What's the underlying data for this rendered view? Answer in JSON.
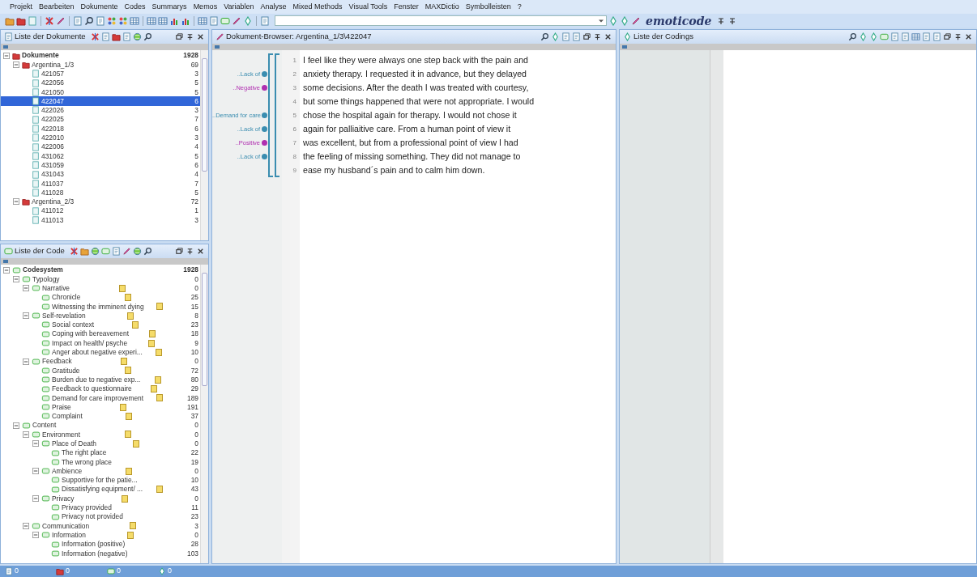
{
  "menu": [
    "Projekt",
    "Bearbeiten",
    "Dokumente",
    "Codes",
    "Summarys",
    "Memos",
    "Variablen",
    "Analyse",
    "Mixed Methods",
    "Visual Tools",
    "Fenster",
    "MAXDictio",
    "Symbolleisten",
    "?"
  ],
  "toolbar": {
    "logo": "emoticode"
  },
  "documents_panel": {
    "title": "Liste der Dokumente",
    "tree": [
      {
        "label": "Dokumente",
        "count": "1928",
        "kind": "root",
        "selected": false,
        "expanded": true,
        "children": [
          {
            "label": "Argentina_1/3",
            "count": "69",
            "kind": "set",
            "selected": false,
            "expanded": true,
            "children": [
              {
                "label": "421057",
                "count": "3",
                "kind": "doc",
                "selected": false
              },
              {
                "label": "422056",
                "count": "5",
                "kind": "doc",
                "selected": false
              },
              {
                "label": "421050",
                "count": "5",
                "kind": "doc",
                "selected": false
              },
              {
                "label": "422047",
                "count": "6",
                "kind": "doc",
                "selected": true
              },
              {
                "label": "422026",
                "count": "3",
                "kind": "doc",
                "selected": false
              },
              {
                "label": "422025",
                "count": "7",
                "kind": "doc",
                "selected": false
              },
              {
                "label": "422018",
                "count": "6",
                "kind": "doc",
                "selected": false
              },
              {
                "label": "422010",
                "count": "3",
                "kind": "doc",
                "selected": false
              },
              {
                "label": "422006",
                "count": "4",
                "kind": "doc",
                "selected": false
              },
              {
                "label": "431062",
                "count": "5",
                "kind": "doc",
                "selected": false
              },
              {
                "label": "431059",
                "count": "6",
                "kind": "doc",
                "selected": false
              },
              {
                "label": "431043",
                "count": "4",
                "kind": "doc",
                "selected": false
              },
              {
                "label": "411037",
                "count": "7",
                "kind": "doc",
                "selected": false
              },
              {
                "label": "411028",
                "count": "5",
                "kind": "doc",
                "selected": false
              }
            ]
          },
          {
            "label": "Argentina_2/3",
            "count": "72",
            "kind": "set",
            "selected": false,
            "expanded": true,
            "children": [
              {
                "label": "411012",
                "count": "1",
                "kind": "doc",
                "selected": false
              },
              {
                "label": "411013",
                "count": "3",
                "kind": "doc",
                "selected": false
              }
            ]
          }
        ]
      }
    ]
  },
  "codes_panel": {
    "title": "Liste der Code",
    "tree": [
      {
        "label": "Codesystem",
        "count": "1928",
        "kind": "root",
        "memo": false,
        "expanded": true,
        "children": [
          {
            "label": "Typology",
            "count": "0",
            "kind": "code",
            "memo": false,
            "expanded": true,
            "children": [
              {
                "label": "Narrative",
                "count": "0",
                "kind": "code",
                "memo": true,
                "expanded": true,
                "children": [
                  {
                    "label": "Chronicle",
                    "count": "25",
                    "kind": "code",
                    "memo": true
                  },
                  {
                    "label": "Witnessing the imminent dying",
                    "count": "15",
                    "kind": "code",
                    "memo": true
                  }
                ]
              },
              {
                "label": "Self-revelation",
                "count": "8",
                "kind": "code",
                "memo": true,
                "expanded": true,
                "children": [
                  {
                    "label": "Social context",
                    "count": "23",
                    "kind": "code",
                    "memo": true
                  },
                  {
                    "label": "Coping with bereavement",
                    "count": "18",
                    "kind": "code",
                    "memo": true
                  },
                  {
                    "label": "Impact on health/ psyche",
                    "count": "9",
                    "kind": "code",
                    "memo": true
                  },
                  {
                    "label": "Anger about negative experi...",
                    "count": "10",
                    "kind": "code",
                    "memo": true
                  }
                ]
              },
              {
                "label": "Feedback",
                "count": "0",
                "kind": "code",
                "memo": true,
                "expanded": true,
                "children": [
                  {
                    "label": "Gratitude",
                    "count": "72",
                    "kind": "code",
                    "memo": true
                  },
                  {
                    "label": "Burden due to negative exp...",
                    "count": "80",
                    "kind": "code",
                    "memo": true
                  },
                  {
                    "label": "Feedback to questionnaire",
                    "count": "29",
                    "kind": "code",
                    "memo": true
                  },
                  {
                    "label": "Demand for care improvement",
                    "count": "189",
                    "kind": "code",
                    "memo": true
                  },
                  {
                    "label": "Praise",
                    "count": "191",
                    "kind": "code",
                    "memo": true
                  },
                  {
                    "label": "Complaint",
                    "count": "37",
                    "kind": "code",
                    "memo": true
                  }
                ]
              }
            ]
          },
          {
            "label": "Content",
            "count": "0",
            "kind": "code",
            "memo": false,
            "expanded": true,
            "children": [
              {
                "label": "Environment",
                "count": "0",
                "kind": "code",
                "memo": true,
                "expanded": true,
                "children": [
                  {
                    "label": "Place of Death",
                    "count": "0",
                    "kind": "code",
                    "memo": true,
                    "expanded": true,
                    "children": [
                      {
                        "label": "The right place",
                        "count": "22",
                        "kind": "code",
                        "memo": false
                      },
                      {
                        "label": "The wrong place",
                        "count": "19",
                        "kind": "code",
                        "memo": false
                      }
                    ]
                  },
                  {
                    "label": "Ambience",
                    "count": "0",
                    "kind": "code",
                    "memo": true,
                    "expanded": true,
                    "children": [
                      {
                        "label": "Supportive for the patie...",
                        "count": "10",
                        "kind": "code",
                        "memo": false
                      },
                      {
                        "label": "Dissatisfying equipment/ ...",
                        "count": "43",
                        "kind": "code",
                        "memo": true
                      }
                    ]
                  },
                  {
                    "label": "Privacy",
                    "count": "0",
                    "kind": "code",
                    "memo": true,
                    "expanded": true,
                    "children": [
                      {
                        "label": "Privacy provided",
                        "count": "11",
                        "kind": "code",
                        "memo": false
                      },
                      {
                        "label": "Privacy not provided",
                        "count": "23",
                        "kind": "code",
                        "memo": false
                      }
                    ]
                  }
                ]
              },
              {
                "label": "Communication",
                "count": "3",
                "kind": "code",
                "memo": true,
                "expanded": true,
                "children": [
                  {
                    "label": "Information",
                    "count": "0",
                    "kind": "code",
                    "memo": true,
                    "expanded": true,
                    "children": [
                      {
                        "label": "Information (positive)",
                        "count": "28",
                        "kind": "code",
                        "memo": false
                      },
                      {
                        "label": "Information (negative)",
                        "count": "103",
                        "kind": "code",
                        "memo": false
                      }
                    ]
                  }
                ]
              }
            ]
          }
        ]
      }
    ]
  },
  "document_browser": {
    "title": "Dokument-Browser: Argentina_1/3\\422047",
    "stripes": [
      {
        "color": "#3a8db0"
      },
      {
        "color": "#3a8db0"
      }
    ],
    "lines": [
      {
        "number": "1",
        "text": "I feel like they were always one step back with the pain and"
      },
      {
        "number": "2",
        "text": "anxiety therapy. I requested it in advance, but they delayed",
        "margin_label": {
          "text": "..Lack of",
          "color": "#3a8db0"
        }
      },
      {
        "number": "3",
        "text": "some decisions. After the death I was treated with courtesy,",
        "margin_label": {
          "text": "..Negative",
          "color": "#b02fb0"
        }
      },
      {
        "number": "4",
        "text": "but some things happened that were not appropriate. I would"
      },
      {
        "number": "5",
        "text": "chose the hospital again for therapy. I would not chose it",
        "margin_label": {
          "text": "..Demand for care",
          "color": "#3a8db0"
        }
      },
      {
        "number": "6",
        "text": "again for palliaitive care. From a human point of view it",
        "margin_label": {
          "text": "..Lack of",
          "color": "#3a8db0"
        }
      },
      {
        "number": "7",
        "text": "was excellent, but from a professional point of view I had",
        "margin_label": {
          "text": "..Positive",
          "color": "#b02fb0"
        }
      },
      {
        "number": "8",
        "text": "the feeling of missing something. They did not manage to",
        "margin_label": {
          "text": "..Lack of",
          "color": "#3a8db0"
        }
      },
      {
        "number": "9",
        "text": "ease my husband´s pain and to calm him down."
      }
    ]
  },
  "codings_panel": {
    "title": "Liste der Codings"
  },
  "status_bar": [
    {
      "count": "0"
    },
    {
      "count": "0"
    },
    {
      "count": "0"
    },
    {
      "count": "0"
    }
  ]
}
